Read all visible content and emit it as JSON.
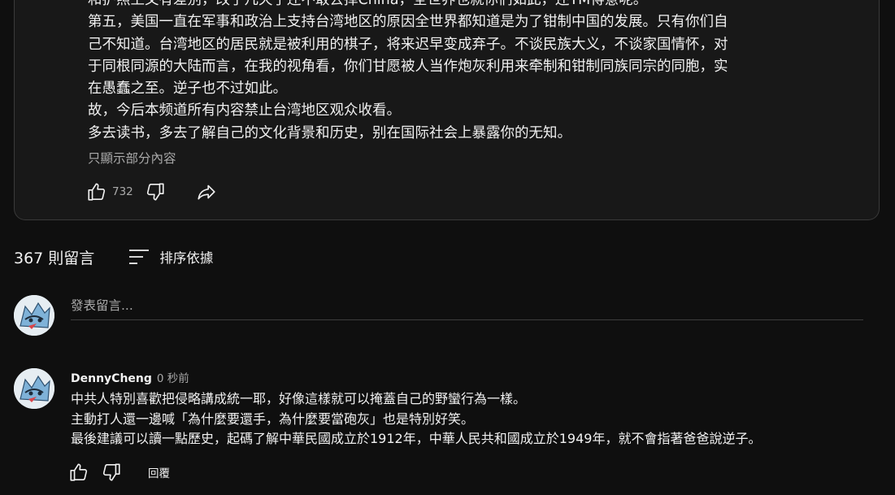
{
  "post": {
    "lines": [
      "和护照上又有差别，改了几天了还不敢去掉China，全世界也就你们如此，还TM得意呢。",
      "第五，美国一直在军事和政治上支持台湾地区的原因全世界都知道是为了钳制中国的发展。只有你们自",
      "己不知道。台湾地区的居民就是被利用的棋子，将来迟早变成弃子。不谈民族大义，不谈家国情怀，对",
      "于同根同源的大陆而言，在我的视角看，你们甘愿被人当作炮灰利用来牵制和钳制同族同宗的同胞，实",
      "在愚蠢之至。逆子也不过如此。",
      "故，今后本频道所有内容禁止台湾地区观众收看。",
      "多去读书，多去了解自己的文化背景和历史，别在国际社会上暴露你的无知。"
    ],
    "show_partial": "只顯示部分內容",
    "like_count": "732"
  },
  "comments_section": {
    "count_label": "367 則留言",
    "sort_label": "排序依據",
    "compose_placeholder": "發表留言..."
  },
  "comment": {
    "author": "DennyCheng",
    "time": "0 秒前",
    "lines": [
      "中共人特別喜歡把侵略講成統一耶，好像這樣就可以掩蓋自己的野蠻行為一樣。",
      "主動打人還一邊喊「為什麼要還手，為什麼要當砲灰」也是特別好笑。",
      "最後建議可以讀一點歷史，起碼了解中華民國成立於1912年，中華人民共和國成立於1949年，就不會指著爸爸說逆子。"
    ],
    "reply_label": "回覆"
  },
  "icons": {
    "like": "thumbs-up-icon",
    "dislike": "thumbs-down-icon",
    "share": "share-icon",
    "sort": "sort-icon",
    "avatar": "avatar-image"
  }
}
